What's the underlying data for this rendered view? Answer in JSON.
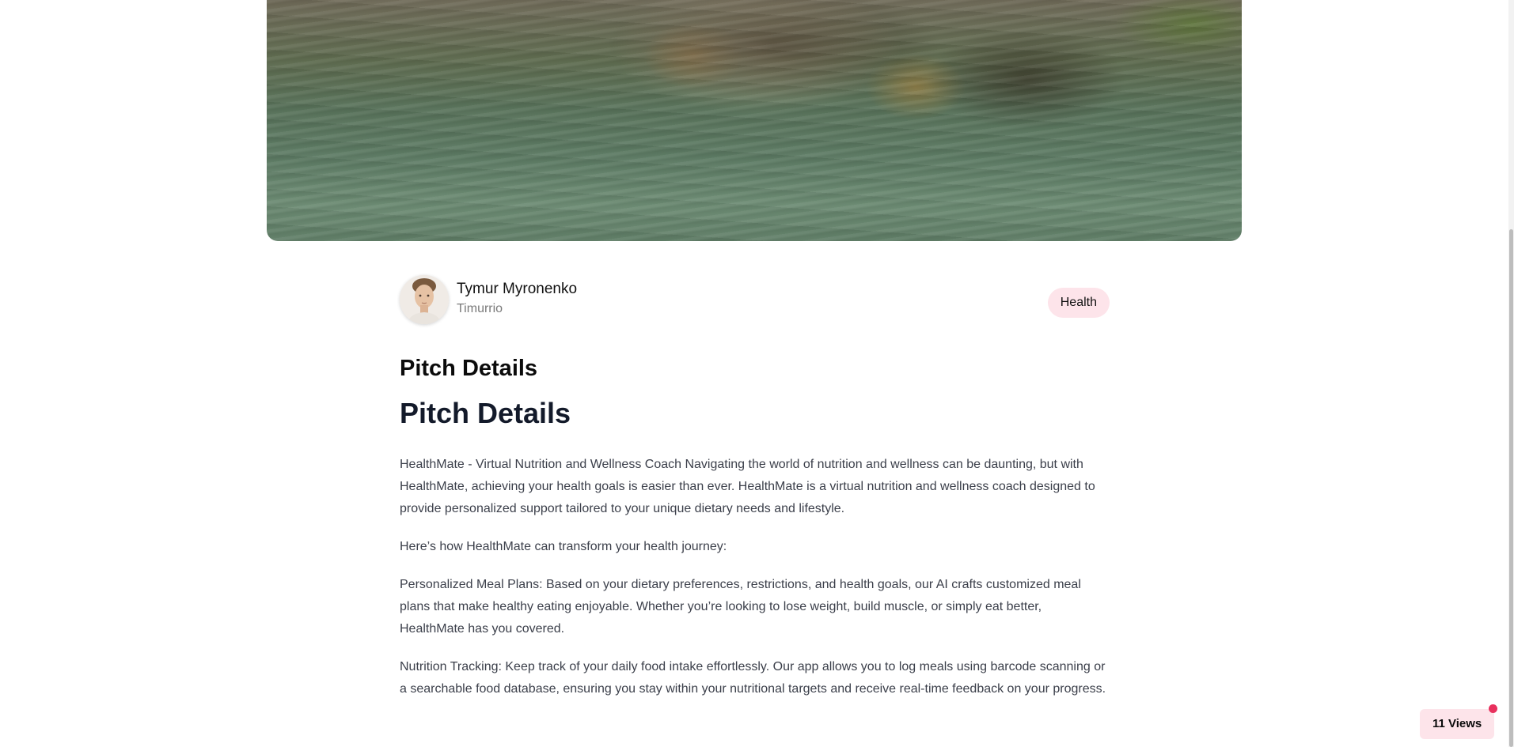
{
  "hero": {
    "alt": "Reflection of a building in rippling green water"
  },
  "author": {
    "name": "Tymur Myronenko",
    "handle": "Timurrio"
  },
  "tag": {
    "label": "Health"
  },
  "title_small": "Pitch Details",
  "title_large": "Pitch Details",
  "body": {
    "paragraphs": [
      "HealthMate - Virtual Nutrition and Wellness Coach Navigating the world of nutrition and wellness can be daunting, but with HealthMate, achieving your health goals is easier than ever. HealthMate is a virtual nutrition and wellness coach designed to provide personalized support tailored to your unique dietary needs and lifestyle.",
      "Here’s how HealthMate can transform your health journey:",
      "Personalized Meal Plans: Based on your dietary preferences, restrictions, and health goals, our AI crafts customized meal plans that make healthy eating enjoyable. Whether you’re looking to lose weight, build muscle, or simply eat better, HealthMate has you covered.",
      "Nutrition Tracking: Keep track of your daily food intake effortlessly. Our app allows you to log meals using barcode scanning or a searchable food database, ensuring you stay within your nutritional targets and receive real-time feedback on your progress."
    ]
  },
  "views": {
    "label": "11 Views"
  },
  "colors": {
    "tag_bg": "#fde4ea",
    "views_dot": "#e8305d",
    "heading": "#131a2a",
    "body_text": "#3b3f4a"
  },
  "icons": {
    "views_indicator": "notification-dot-icon"
  }
}
